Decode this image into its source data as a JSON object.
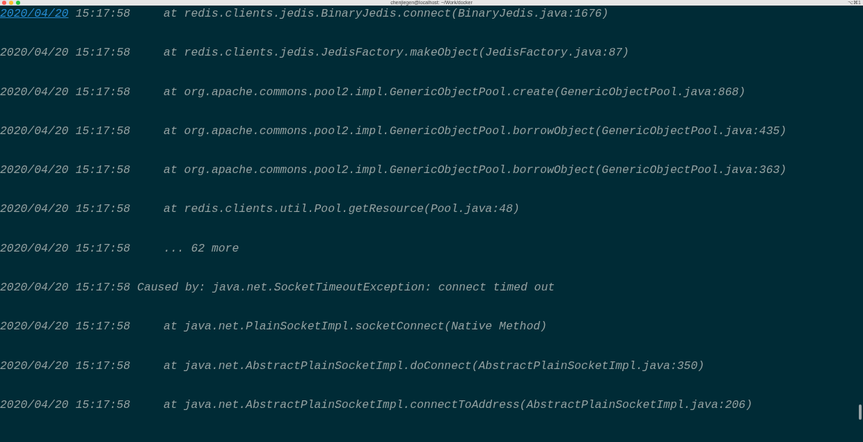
{
  "window": {
    "title": "chenjiegen@localhost: ~/Work/docker",
    "shortcut": "⌥⌘1"
  },
  "lines": [
    {
      "date": "2020/04/20",
      "time": "15:17:58",
      "kind": "frame",
      "date_link": true,
      "message": "at redis.clients.jedis.BinaryJedis.connect(BinaryJedis.java:1676)"
    },
    {
      "date": "2020/04/20",
      "time": "15:17:58",
      "kind": "frame",
      "date_link": false,
      "message": "at redis.clients.jedis.JedisFactory.makeObject(JedisFactory.java:87)"
    },
    {
      "date": "2020/04/20",
      "time": "15:17:58",
      "kind": "frame",
      "date_link": false,
      "message": "at org.apache.commons.pool2.impl.GenericObjectPool.create(GenericObjectPool.java:868)"
    },
    {
      "date": "2020/04/20",
      "time": "15:17:58",
      "kind": "frame",
      "date_link": false,
      "message": "at org.apache.commons.pool2.impl.GenericObjectPool.borrowObject(GenericObjectPool.java:435)"
    },
    {
      "date": "2020/04/20",
      "time": "15:17:58",
      "kind": "frame",
      "date_link": false,
      "message": "at org.apache.commons.pool2.impl.GenericObjectPool.borrowObject(GenericObjectPool.java:363)"
    },
    {
      "date": "2020/04/20",
      "time": "15:17:58",
      "kind": "frame",
      "date_link": false,
      "message": "at redis.clients.util.Pool.getResource(Pool.java:48)"
    },
    {
      "date": "2020/04/20",
      "time": "15:17:58",
      "kind": "frame",
      "date_link": false,
      "message": "... 62 more"
    },
    {
      "date": "2020/04/20",
      "time": "15:17:58",
      "kind": "cause",
      "date_link": false,
      "message": "Caused by: java.net.SocketTimeoutException: connect timed out"
    },
    {
      "date": "2020/04/20",
      "time": "15:17:58",
      "kind": "frame",
      "date_link": false,
      "message": "at java.net.PlainSocketImpl.socketConnect(Native Method)"
    },
    {
      "date": "2020/04/20",
      "time": "15:17:58",
      "kind": "frame",
      "date_link": false,
      "message": "at java.net.AbstractPlainSocketImpl.doConnect(AbstractPlainSocketImpl.java:350)"
    },
    {
      "date": "2020/04/20",
      "time": "15:17:58",
      "kind": "frame",
      "date_link": false,
      "message": "at java.net.AbstractPlainSocketImpl.connectToAddress(AbstractPlainSocketImpl.java:206)"
    }
  ]
}
